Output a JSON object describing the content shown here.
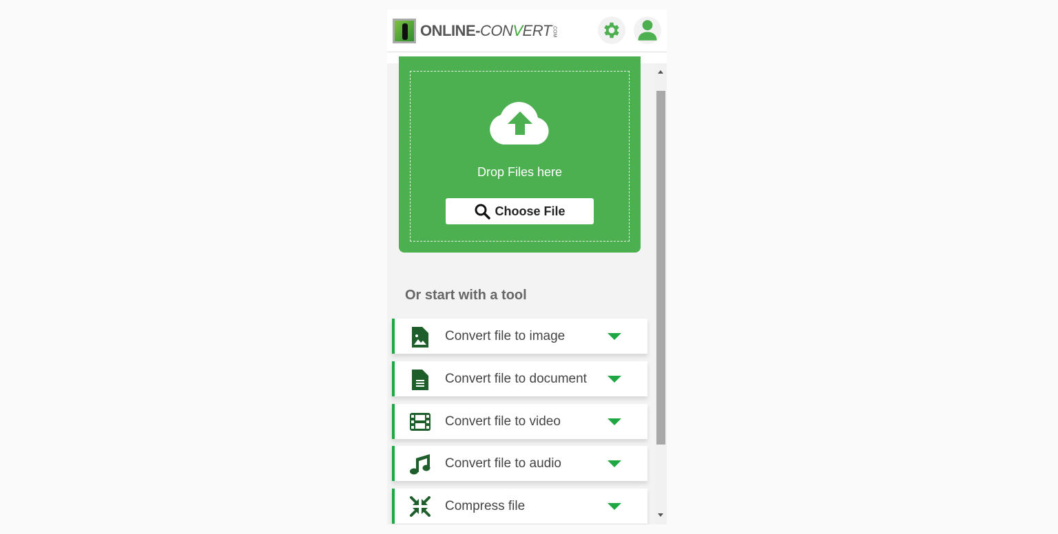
{
  "header": {
    "logo_text_main": "ONLINE-",
    "logo_text_accent": "CONVERT",
    "logo_suffix": ".COM",
    "settings_icon": "gear-icon",
    "account_icon": "user-icon"
  },
  "upload": {
    "drop_text": "Drop Files here",
    "choose_label": "Choose File",
    "icon": "cloud-upload-icon"
  },
  "tools": {
    "title": "Or start with a tool",
    "items": [
      {
        "label": "Convert file to image",
        "icon": "file-image-icon"
      },
      {
        "label": "Convert file to document",
        "icon": "file-document-icon"
      },
      {
        "label": "Convert file to video",
        "icon": "film-icon"
      },
      {
        "label": "Convert file to audio",
        "icon": "music-icon"
      },
      {
        "label": "Compress file",
        "icon": "compress-icon"
      }
    ]
  },
  "colors": {
    "brand": "#4caf50",
    "accent": "#1fa743",
    "icon": "#1e5e2a"
  }
}
